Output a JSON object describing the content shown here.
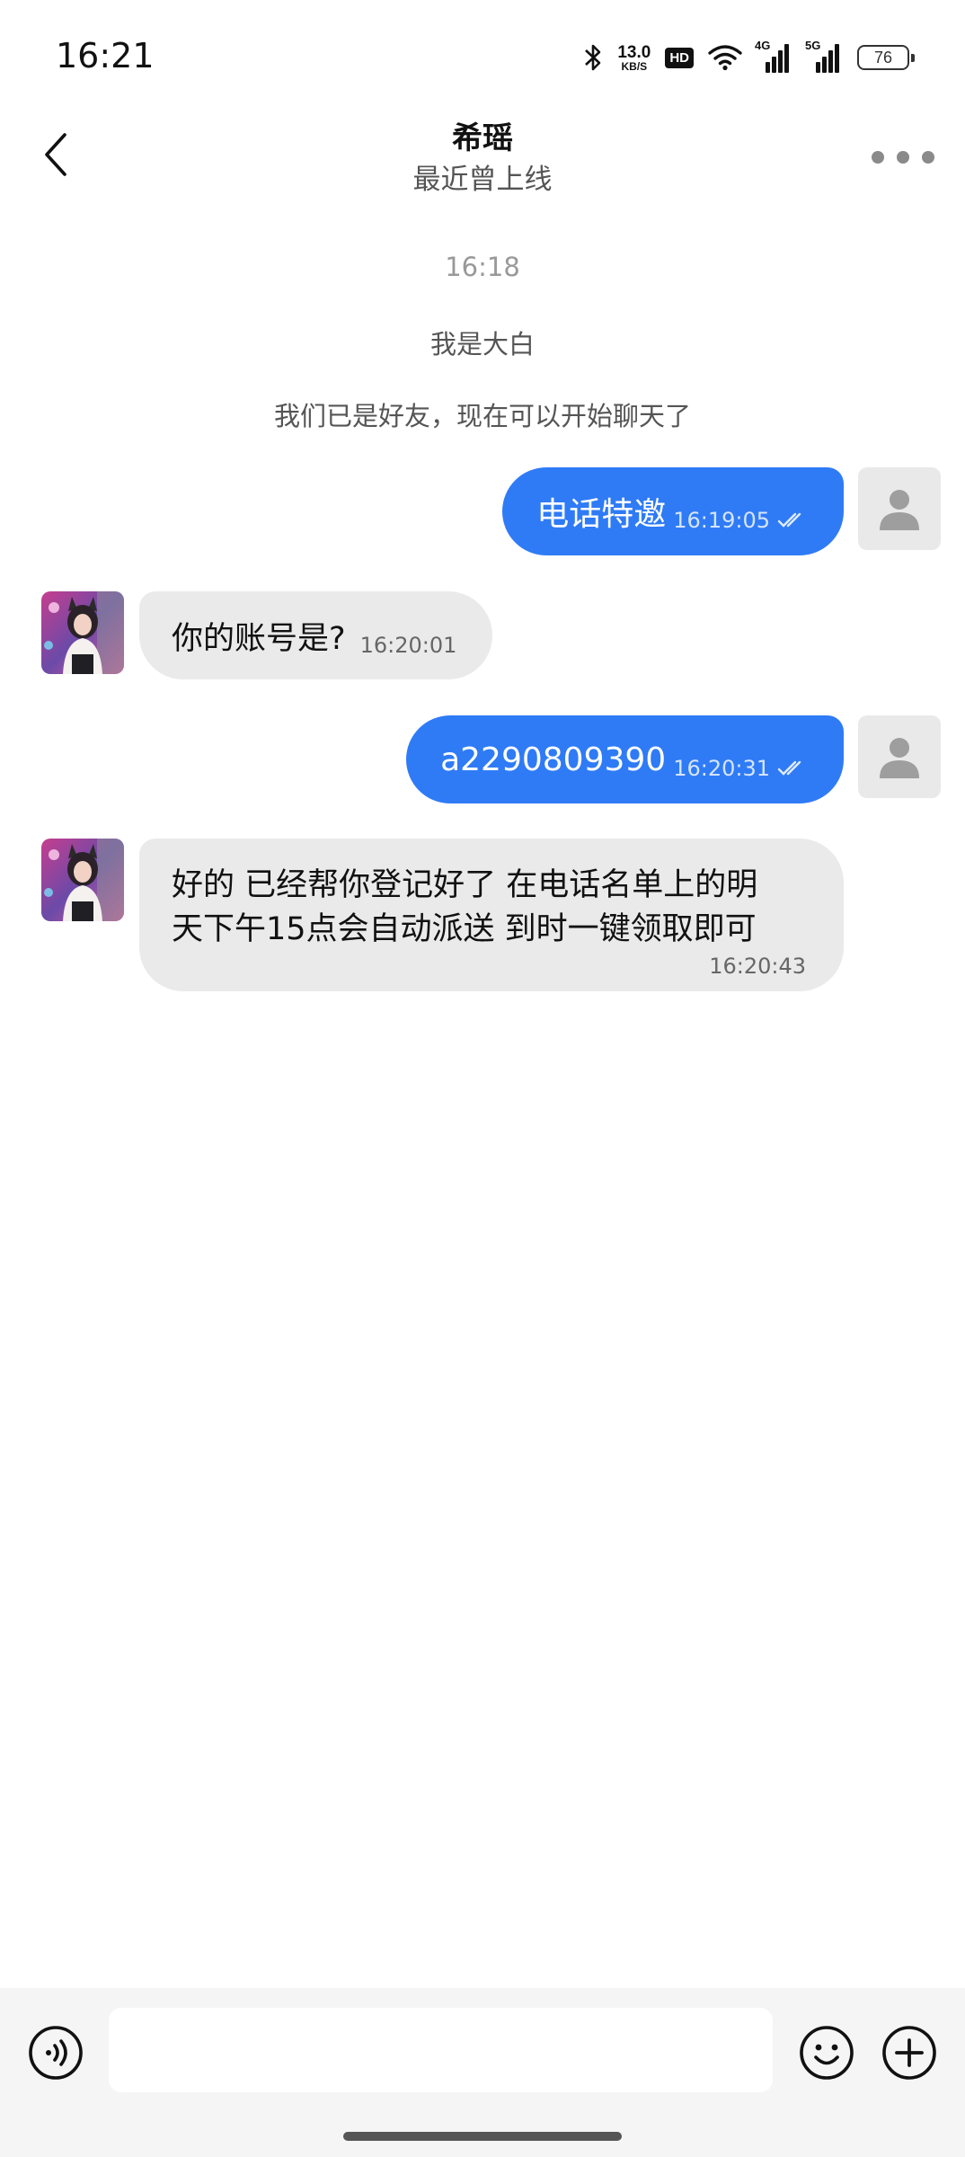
{
  "status_bar": {
    "time": "16:21",
    "net_speed_value": "13.0",
    "net_speed_unit": "KB/S",
    "hd_label": "HD",
    "signal1_tag": "4G",
    "signal2_tag": "5G",
    "battery_level": "76"
  },
  "header": {
    "title": "希瑶",
    "subtitle": "最近曾上线"
  },
  "chat": {
    "timestamp": "16:18",
    "system_messages": [
      "我是大白",
      "我们已是好友，现在可以开始聊天了"
    ],
    "messages": [
      {
        "direction": "out",
        "text": "电话特邀",
        "time": "16:19:05"
      },
      {
        "direction": "in",
        "text": "你的账号是?",
        "time": "16:20:01"
      },
      {
        "direction": "out",
        "text": "a2290809390",
        "time": "16:20:31"
      },
      {
        "direction": "in",
        "text_line1": "好的 已经帮你登记好了  在电话名单上的明",
        "text_line2": "天下午15点会自动派送  到时一键领取即可",
        "time": "16:20:43"
      }
    ]
  },
  "input": {
    "placeholder": ""
  },
  "colors": {
    "outgoing_bubble": "#2f7bf6",
    "incoming_bubble": "#eaeaea",
    "input_bar": "#f5f5f5"
  }
}
